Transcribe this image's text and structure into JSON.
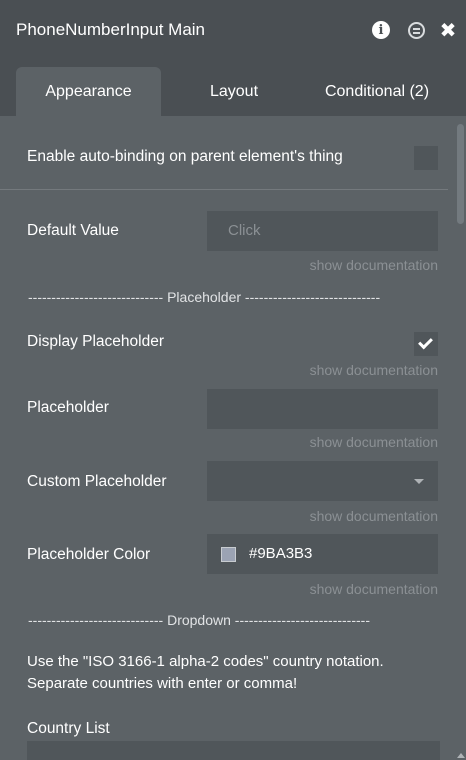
{
  "panel": {
    "title": "PhoneNumberInput Main"
  },
  "tabs": [
    {
      "label": "Appearance",
      "active": true
    },
    {
      "label": "Layout",
      "active": false
    },
    {
      "label": "Conditional (2)",
      "active": false
    }
  ],
  "auto_binding": {
    "label": "Enable auto-binding on parent element's thing",
    "checked": false
  },
  "default_value": {
    "label": "Default Value",
    "placeholder": "Click",
    "doc": "show documentation"
  },
  "placeholder_section": {
    "title": "----------------------------- Placeholder -----------------------------"
  },
  "display_placeholder": {
    "label": "Display Placeholder",
    "checked": true,
    "doc": "show documentation"
  },
  "placeholder": {
    "label": "Placeholder",
    "value": "",
    "doc": "show documentation"
  },
  "custom_placeholder": {
    "label": "Custom Placeholder",
    "value": "",
    "doc": "show documentation"
  },
  "placeholder_color": {
    "label": "Placeholder Color",
    "value": "#9BA3B3",
    "doc": "show documentation"
  },
  "dropdown_section": {
    "title": "----------------------------- Dropdown -----------------------------"
  },
  "country_note": {
    "text": "Use the \"ISO 3166-1 alpha-2 codes\" country notation. Separate countries with enter or comma!"
  },
  "country_list": {
    "label": "Country List",
    "value": ""
  },
  "colors": {
    "panel_bg": "#5c6266",
    "header_bg": "#4a4f53",
    "field_bg": "#50565a",
    "muted_text": "#8b9094",
    "swatch": "#9BA3B3"
  },
  "icons": {
    "info": "info-icon",
    "comment": "comment-icon",
    "close": "close-icon",
    "check": "check-icon",
    "dropdown": "chevron-down-icon"
  }
}
